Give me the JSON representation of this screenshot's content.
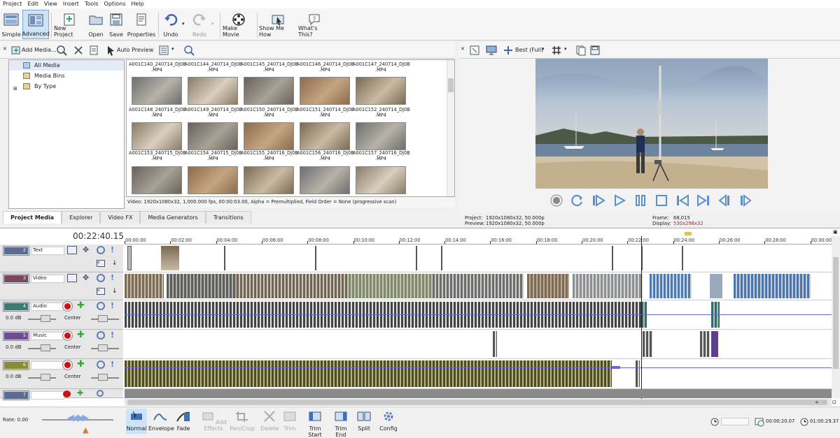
{
  "menu": [
    "Project",
    "Edit",
    "View",
    "Insert",
    "Tools",
    "Options",
    "Help"
  ],
  "toolbar": {
    "simple": "Simple",
    "advanced": "Advanced",
    "new_project": "New Project",
    "open": "Open",
    "save": "Save",
    "properties": "Properties",
    "undo": "Undo",
    "redo": "Redo",
    "make_movie": "Make Movie",
    "show_me_how": "Show Me How",
    "whats_this": "What's This?"
  },
  "media_toolbar": {
    "add_media": "Add Media...",
    "auto_preview": "Auto Preview"
  },
  "tree": [
    "All Media",
    "Media Bins",
    "By Type"
  ],
  "thumbs_row0": [
    "A001C140_240714_DJ0B\n.MP4",
    "A001C144_240714_DJ0B\n.MP4",
    "A001C145_240714_DJ0B\n.MP4",
    "A001C146_240714_DJ0B\n.MP4",
    "A001C147_240714_DJ0B\n.MP4"
  ],
  "thumbs_row1": [
    "A001C148_240714_DJ0B\n.MP4",
    "A001C149_240714_DJ0B\n.MP4",
    "A001C150_240714_DJ0B\n.MP4",
    "A001C151_240714_DJ0B\n.MP4",
    "A001C152_240714_DJ0B\n.MP4"
  ],
  "thumbs_row2": [
    "A001C153_240715_DJ0B\n.MP4",
    "A001C154_240715_DJ0B\n.MP4",
    "A001C155_240716_DJ0B\n.MP4",
    "A001C156_240716_DJ0B\n.MP4",
    "A001C157_240716_DJ0B\n.MP4"
  ],
  "media_status": "Video: 1920x1080x32, 1,000.000 fps, 00:00:03.00, Alpha = Premultiplied, Field Order = None (progressive scan)",
  "tabs": [
    "Project Media",
    "Explorer",
    "Video FX",
    "Media Generators",
    "Transitions"
  ],
  "preview": {
    "quality": "Best (Full)",
    "project_label": "Project:",
    "project_val": "1920x1080x32, 50.000p",
    "preview_label": "Preview:",
    "preview_val": "1920x1080x32, 50.000p",
    "frame_label": "Frame:",
    "frame_val": "68,015",
    "display_label": "Display:",
    "display_val": "530x298x32"
  },
  "timecode": "00:22:40.15",
  "ruler": [
    "00:00:00",
    "00:02:00",
    "00:04:00",
    "00:06:00",
    "00:08:00",
    "00:10:00",
    "00:12:00",
    "00:14:00",
    "00:16:00",
    "00:18:00",
    "00:20:00",
    "00:22:00",
    "00:24:00",
    "00:26:00",
    "00:28:00",
    "00:30:00"
  ],
  "tracks": [
    {
      "num": "2",
      "name": "Text"
    },
    {
      "num": "3",
      "name": "Video"
    },
    {
      "num": "4",
      "name": "Audio",
      "vol": "0.0 dB",
      "pan": "Center"
    },
    {
      "num": "5",
      "name": "Music",
      "vol": "0.0 dB",
      "pan": "Center"
    },
    {
      "num": "6",
      "name": "",
      "vol": "0.0 dB",
      "pan": "Center"
    },
    {
      "num": "7",
      "name": ""
    }
  ],
  "rate": "Rate: 0.00",
  "bottom": {
    "normal": "Normal",
    "envelope": "Envelope",
    "fade": "Fade",
    "add_effects": "Add Effects",
    "pan_crop": "Pan/Crop",
    "delete": "Delete",
    "trim": "Trim",
    "trim_start": "Trim Start",
    "trim_end": "Trim End",
    "split": "Split",
    "config": "Config"
  },
  "time_fields": {
    "t2": "00:00:20.07",
    "t3": "01:00:29.37"
  }
}
